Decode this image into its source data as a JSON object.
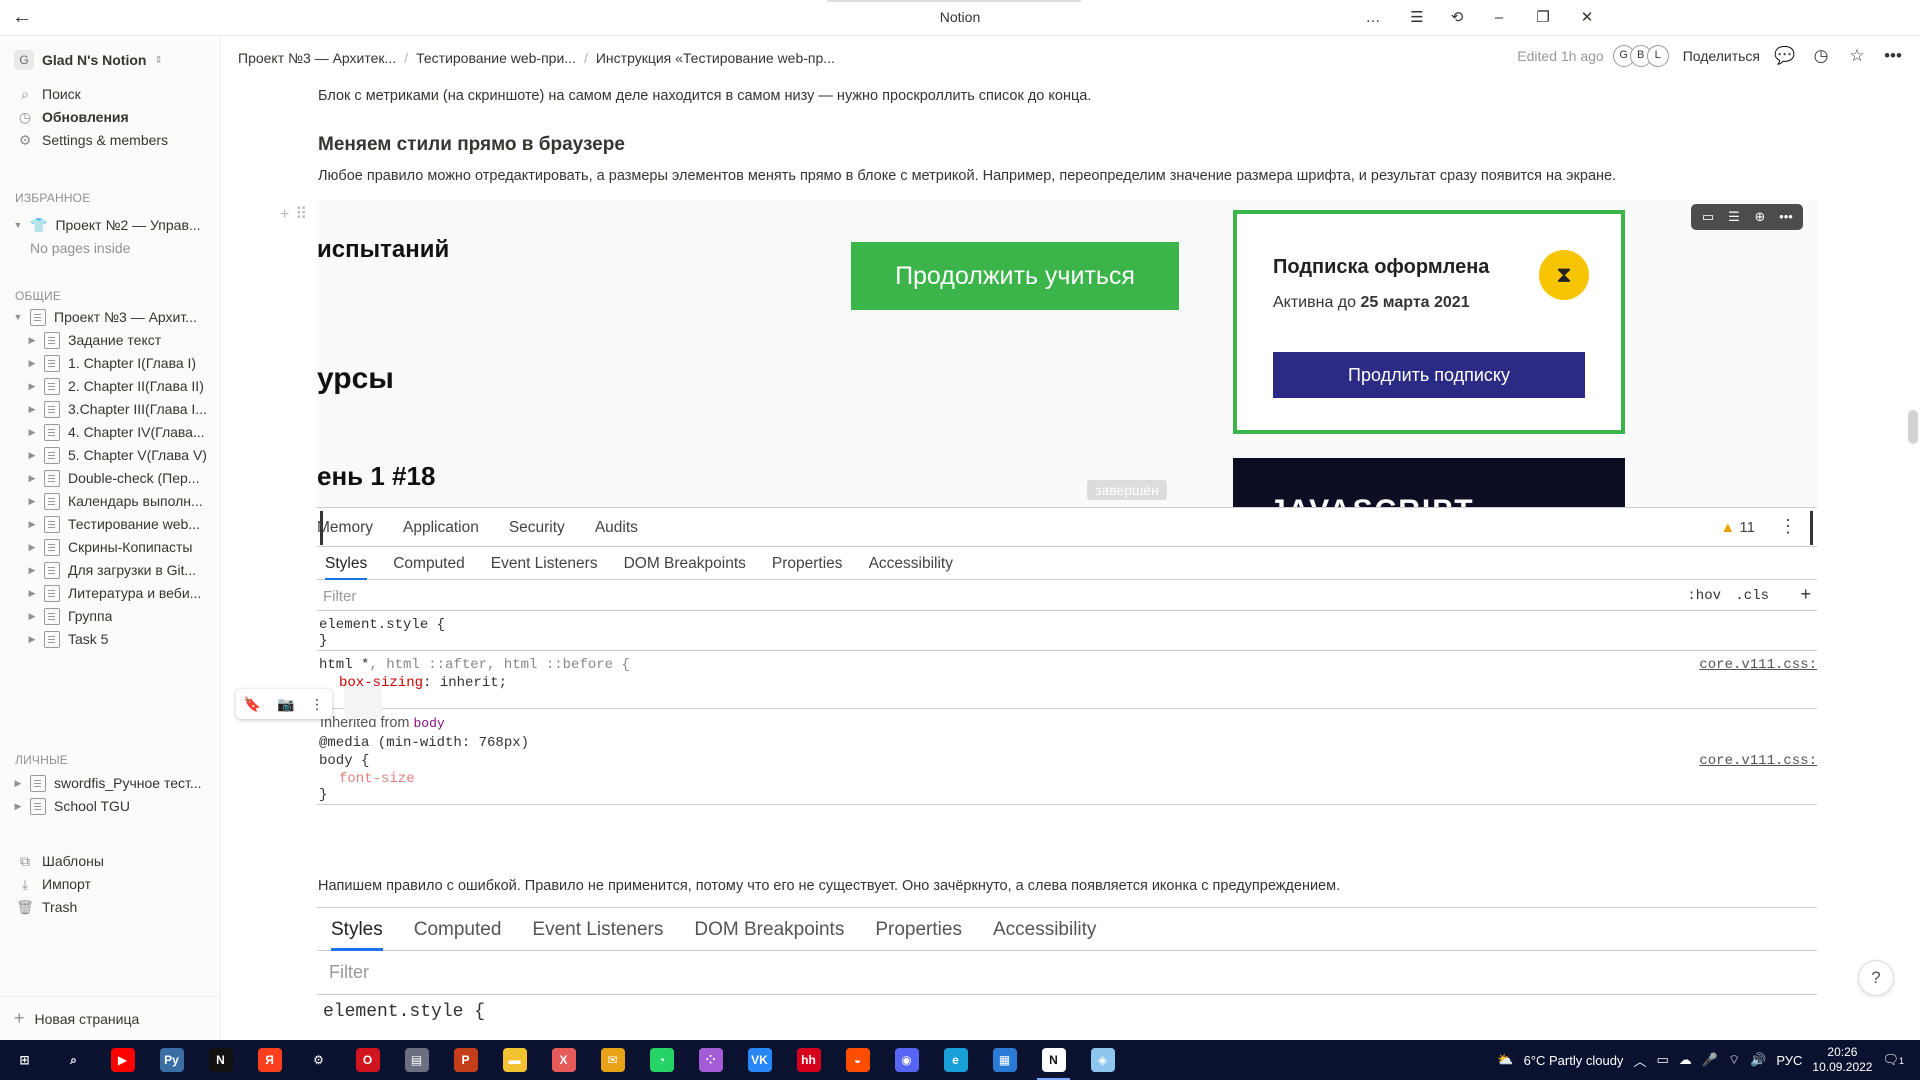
{
  "window": {
    "title": "Notion",
    "controls": [
      "…",
      "☰",
      "⟲",
      "–",
      "❐",
      "✕"
    ]
  },
  "sidebar": {
    "workspace": {
      "badge": "G",
      "name": "Glad N's Notion"
    },
    "top_items": [
      {
        "icon": "search-icon",
        "label": "Поиск"
      },
      {
        "icon": "clock-icon",
        "label": "Обновления"
      },
      {
        "icon": "gear-icon",
        "label": "Settings & members"
      }
    ],
    "favorites_header": "ИЗБРАННОЕ",
    "favorites": [
      {
        "label": "Проект №2 — Управ...",
        "expanded": true
      }
    ],
    "favorites_empty": "No pages inside",
    "shared_header": "ОБЩИЕ",
    "shared": [
      {
        "label": "Проект №3 — Архит...",
        "level": 0,
        "expanded": true
      },
      {
        "label": "Задание текст",
        "level": 1
      },
      {
        "label": "1. Chapter I(Глава I)",
        "level": 1
      },
      {
        "label": "2. Chapter II(Глава II)",
        "level": 1
      },
      {
        "label": "3.Chapter III(Глава I...",
        "level": 1
      },
      {
        "label": "4. Chapter IV(Глава...",
        "level": 1
      },
      {
        "label": "5. Chapter V(Глава V)",
        "level": 1
      },
      {
        "label": "Double-check (Пер...",
        "level": 1
      },
      {
        "label": "Календарь выполн...",
        "level": 1
      },
      {
        "label": "Тестирование web...",
        "level": 1
      },
      {
        "label": "Скрины-Копипасты",
        "level": 1
      },
      {
        "label": "Для загрузки в Git...",
        "level": 1
      },
      {
        "label": "Литература и веби...",
        "level": 1
      },
      {
        "label": "Группа",
        "level": 1
      },
      {
        "label": "Task 5",
        "level": 1
      }
    ],
    "private_header": "ЛИЧНЫЕ",
    "private": [
      {
        "label": "swordfis_Ручное тест..."
      },
      {
        "label": "School TGU"
      }
    ],
    "bottom_items": [
      {
        "icon": "templates-icon",
        "label": "Шаблоны"
      },
      {
        "icon": "import-icon",
        "label": "Импорт"
      },
      {
        "icon": "trash-icon",
        "label": "Trash"
      }
    ],
    "new_page": "Новая страница"
  },
  "topbar": {
    "breadcrumbs": [
      "Проект №3 — Архитек...",
      "Тестирование web-при...",
      "Инструкция «Тестирование web-пр..."
    ],
    "edited": "Edited 1h ago",
    "avatars": [
      "G",
      "B",
      "L"
    ],
    "share": "Поделиться"
  },
  "content": {
    "p1": "Блок с метриками (на скриншоте) на самом деле находится в самом низу — нужно проскроллить список до конца.",
    "h1": "Меняем стили прямо в браузере",
    "p2": "Любое правило можно отредактировать, а размеры элементов менять прямо в блоке с метрикой. Например, переопределим значение размера шрифта, и результат сразу появится на экране.",
    "p3": "Напишем правило с ошибкой. Правило не применится, потому что его не существует. Оно зачёркнуто, а слева появляется иконка с предупреждением."
  },
  "shot1": {
    "web": {
      "t1": "испытаний",
      "t2": "урсы",
      "t3": "ень 1 #18",
      "green_button": "Продолжить учиться",
      "card_title": "Подписка оформлена",
      "card_active_prefix": "Активна до",
      "card_active_date": "25 марта 2021",
      "card_button": "Продлить подписку",
      "dark_card_text": "JAVASCRIPT",
      "done_badge": "завершён"
    },
    "devtools": {
      "top_tabs": [
        "Memory",
        "Application",
        "Security",
        "Audits"
      ],
      "warnings": "11",
      "sub_tabs": [
        "Styles",
        "Computed",
        "Event Listeners",
        "DOM Breakpoints",
        "Properties",
        "Accessibility"
      ],
      "active_sub_tab": "Styles",
      "filter_placeholder": "Filter",
      "hov": ":hov",
      "cls": ".cls",
      "rule1_line1": "element.style {",
      "rule1_line2": "}",
      "rule2_selector_main": "html *",
      "rule2_selector_rest": ", html ::after, html ::before {",
      "rule2_prop": "box-sizing",
      "rule2_value": " inherit;",
      "rule2_close": "}",
      "rule2_src": "core.v111.css:",
      "inherited_label": "Inherited from",
      "inherited_from": "body",
      "rule3_media": "@media (min-width: 768px)",
      "rule3_selector": "body {",
      "rule3_prop": "font-size",
      "rule3_close": "}",
      "rule3_src": "core.v111.css:"
    }
  },
  "shot2": {
    "sub_tabs": [
      "Styles",
      "Computed",
      "Event Listeners",
      "DOM Breakpoints",
      "Properties",
      "Accessibility"
    ],
    "filter_placeholder": "Filter",
    "rule_line": "element.style {"
  },
  "taskbar": {
    "weather": "6°C  Partly cloudy",
    "lang": "РУС",
    "time": "20:26",
    "date": "10.09.2022",
    "notifications": "1",
    "apps": [
      {
        "name": "windows-start",
        "glyph": "⊞",
        "color": "#0b1230"
      },
      {
        "name": "search",
        "glyph": "⌕",
        "color": "#0b1230"
      },
      {
        "name": "youtube",
        "glyph": "▶",
        "color": "#ff0000"
      },
      {
        "name": "python",
        "glyph": "Py",
        "color": "#3a6ea5"
      },
      {
        "name": "notion",
        "glyph": "N",
        "color": "#111111"
      },
      {
        "name": "yandex",
        "glyph": "Я",
        "color": "#fc3f1d"
      },
      {
        "name": "settings",
        "glyph": "⚙",
        "color": "#0b1230"
      },
      {
        "name": "opera",
        "glyph": "O",
        "color": "#d1151e"
      },
      {
        "name": "files",
        "glyph": "▤",
        "color": "#6b6f80"
      },
      {
        "name": "powerpoint",
        "glyph": "P",
        "color": "#c43e1c"
      },
      {
        "name": "explorer",
        "glyph": "▬",
        "color": "#f2c230"
      },
      {
        "name": "app-red",
        "glyph": "X",
        "color": "#e65a5a"
      },
      {
        "name": "mail",
        "glyph": "✉",
        "color": "#e8a317"
      },
      {
        "name": "whatsapp",
        "glyph": "◔",
        "color": "#25d366"
      },
      {
        "name": "app-dots",
        "glyph": "⁘",
        "color": "#a35bd6"
      },
      {
        "name": "vk",
        "glyph": "VK",
        "color": "#2787f5"
      },
      {
        "name": "hh",
        "glyph": "hh",
        "color": "#d6001c"
      },
      {
        "name": "app-orange",
        "glyph": "◒",
        "color": "#ff4d00"
      },
      {
        "name": "discord",
        "glyph": "◉",
        "color": "#5865f2"
      },
      {
        "name": "edge",
        "glyph": "e",
        "color": "#1aa0d8"
      },
      {
        "name": "photos",
        "glyph": "▦",
        "color": "#2a7bd6"
      },
      {
        "name": "notion-active",
        "glyph": "N",
        "color": "#ffffff",
        "text": "#111111",
        "active": true
      },
      {
        "name": "app-blue",
        "glyph": "◈",
        "color": "#8fc6f0"
      }
    ]
  }
}
